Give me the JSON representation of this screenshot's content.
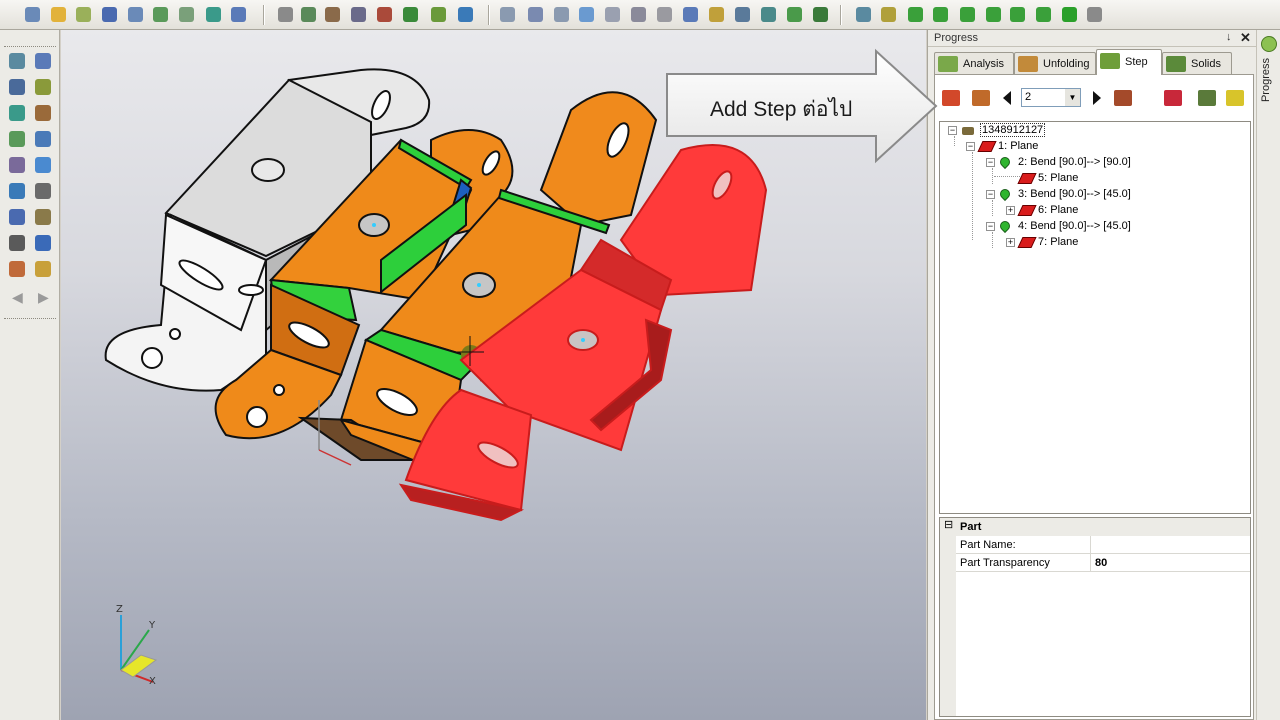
{
  "toolbar": {
    "icons": [
      "new-file-icon",
      "open-folder-icon",
      "open-recent-icon",
      "save-icon",
      "save-as-icon",
      "print-icon",
      "export-icon",
      "zoom-fit-icon",
      "window-icon",
      "view-icon",
      "render-icon",
      "measure-icon",
      "select-icon",
      "cut-icon",
      "analysis-icon",
      "unfold-icon",
      "rotate-icon",
      "cylinder-icon",
      "cylinder-2-icon",
      "cylinder-3-icon",
      "cylinder-4-icon",
      "cylinder-5-icon",
      "cylinder-6-icon",
      "spring-icon",
      "box-icon",
      "grid-icon",
      "zoom-in-icon",
      "zoom-area-icon",
      "measure-line-icon",
      "tool-icon",
      "arrow-tool-icon",
      "helmet-icon",
      "view-cube-1-icon",
      "view-cube-2-icon",
      "view-cube-3-icon",
      "view-cube-4-icon",
      "view-cube-5-icon",
      "view-cube-6-icon",
      "view-cube-solid-icon",
      "scale-icon"
    ]
  },
  "panel": {
    "title": "Progress",
    "pin_glyph": "↓",
    "close_glyph": "✕",
    "tabs": [
      {
        "label": "Analysis"
      },
      {
        "label": "Unfolding"
      },
      {
        "label": "Step"
      },
      {
        "label": "Solids"
      }
    ],
    "step_combo_value": "2",
    "tree": {
      "root": "1348912127",
      "items": [
        {
          "label": "1: Plane",
          "type": "plane"
        },
        {
          "label": "2: Bend [90.0]--> [90.0]",
          "type": "bend"
        },
        {
          "label": "5: Plane",
          "type": "plane"
        },
        {
          "label": "3: Bend [90.0]--> [45.0]",
          "type": "bend"
        },
        {
          "label": "6: Plane",
          "type": "plane"
        },
        {
          "label": "4: Bend [90.0]--> [45.0]",
          "type": "bend"
        },
        {
          "label": "7: Plane",
          "type": "plane"
        }
      ]
    },
    "properties": {
      "category": "Part",
      "rows": [
        {
          "key": "Part Name:",
          "value": ""
        },
        {
          "key": "Part Transparency",
          "value": "80"
        }
      ]
    }
  },
  "sidetab": {
    "label": "Progress"
  },
  "callout": {
    "text": "Add Step ต่อไป"
  },
  "axes": {
    "z": "Z",
    "y": "Y",
    "x": "X"
  }
}
